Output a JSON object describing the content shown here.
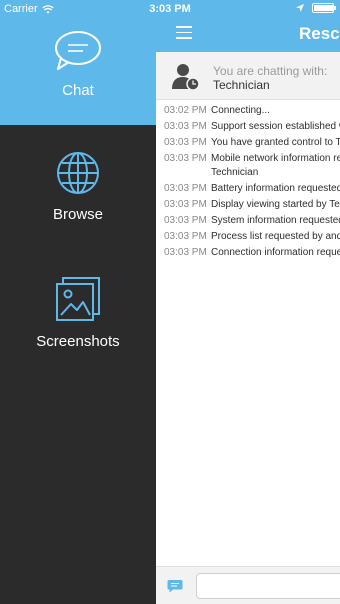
{
  "status_bar": {
    "carrier": "Carrier",
    "time": "3:03 PM",
    "battery_level": 1.0,
    "icons": [
      "wifi-icon",
      "location-arrow-icon",
      "battery-icon"
    ]
  },
  "sidebar": {
    "items": [
      {
        "label": "Chat",
        "icon": "chat-bubble-icon",
        "active": true
      },
      {
        "label": "Browse",
        "icon": "globe-icon",
        "active": false
      },
      {
        "label": "Screenshots",
        "icon": "screenshots-icon",
        "active": false
      }
    ]
  },
  "header": {
    "title": "Rescu",
    "menu_icon": "hamburger-menu-icon"
  },
  "session": {
    "chatting_label": "You are chatting with:",
    "technician": "Technician"
  },
  "log": [
    {
      "time": "03:02 PM",
      "message": "Connecting..."
    },
    {
      "time": "03:03 PM",
      "message": "Support session established w"
    },
    {
      "time": "03:03 PM",
      "message": "You have granted control to T"
    },
    {
      "time": "03:03 PM",
      "message": "Mobile network information re Technician"
    },
    {
      "time": "03:03 PM",
      "message": "Battery information requested"
    },
    {
      "time": "03:03 PM",
      "message": "Display viewing started by Te"
    },
    {
      "time": "03:03 PM",
      "message": "System information requested"
    },
    {
      "time": "03:03 PM",
      "message": "Process list requested by and"
    },
    {
      "time": "03:03 PM",
      "message": "Connection information reque"
    }
  ],
  "composer": {
    "icon": "chat-compose-icon",
    "placeholder": "",
    "value": ""
  },
  "colors": {
    "accent": "#5fb8ea",
    "sidebar_bg": "#2b2b2b",
    "icon_blue": "#5fb8ea"
  }
}
